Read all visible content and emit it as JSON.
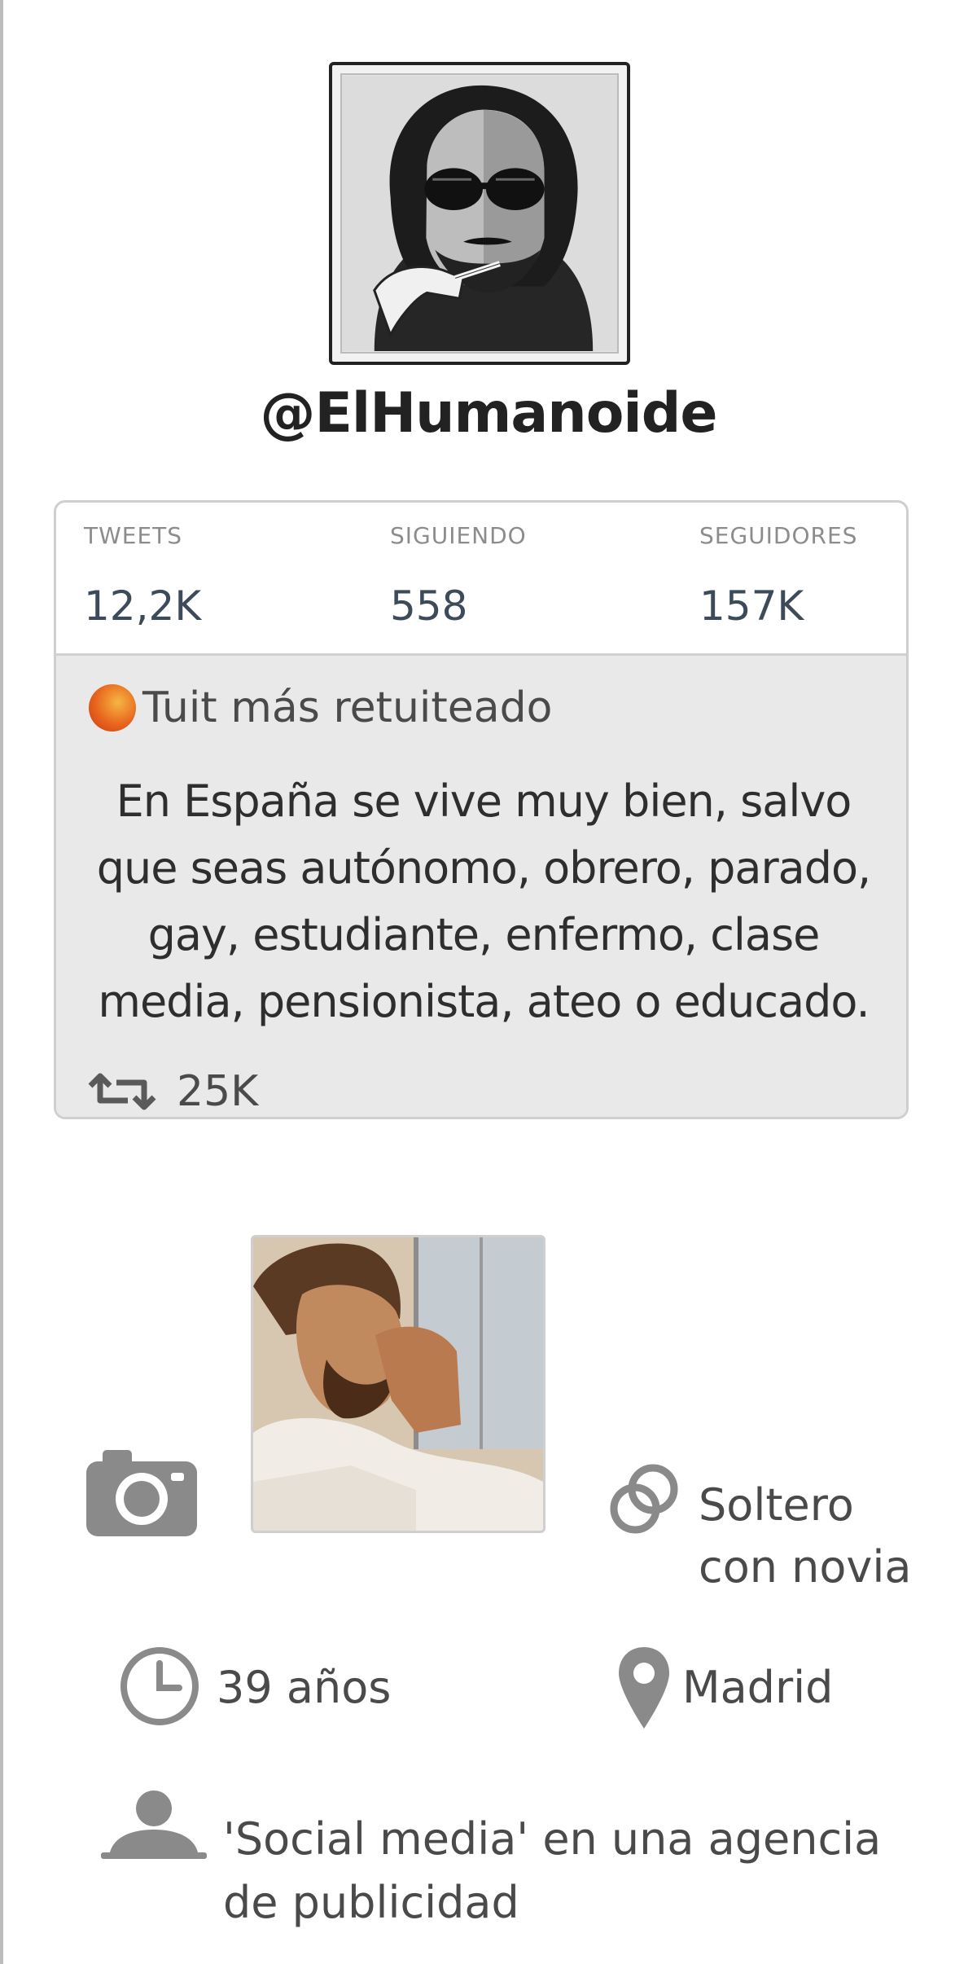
{
  "profile": {
    "handle": "@ElHumanoide"
  },
  "stats": [
    {
      "label": "TWEETS",
      "value": "12,2K"
    },
    {
      "label": "SIGUIENDO",
      "value": "558"
    },
    {
      "label": "SEGUIDORES",
      "value": "157K"
    }
  ],
  "top_tweet": {
    "heading": "Tuit más retuiteado",
    "lines": [
      "En España se vive muy bien, salvo",
      "que seas autónomo, obrero, parado,",
      "gay, estudiante, enfermo, clase",
      "media, pensionista, ateo o educado."
    ],
    "retweets": "25K"
  },
  "details": {
    "relationship_line1": "Soltero",
    "relationship_line2": "con novia",
    "age": "39 años",
    "location": "Madrid",
    "job_line1": "'Social media' en una agencia",
    "job_line2": "de publicidad"
  },
  "icons": {
    "avatar": "illustrated-avatar",
    "photo": "photo-portrait",
    "camera": "camera-icon",
    "relationship": "rings-icon",
    "age": "clock-icon",
    "location": "location-pin-icon",
    "job": "person-icon",
    "retweet": "retweet-icon",
    "badge": "orange-dot-icon"
  },
  "colors": {
    "accent": "#e8641e",
    "icon_gray": "#8a8a8a",
    "tweet_bg": "#e9e9e9",
    "stat_value": "#3c4a5a"
  }
}
